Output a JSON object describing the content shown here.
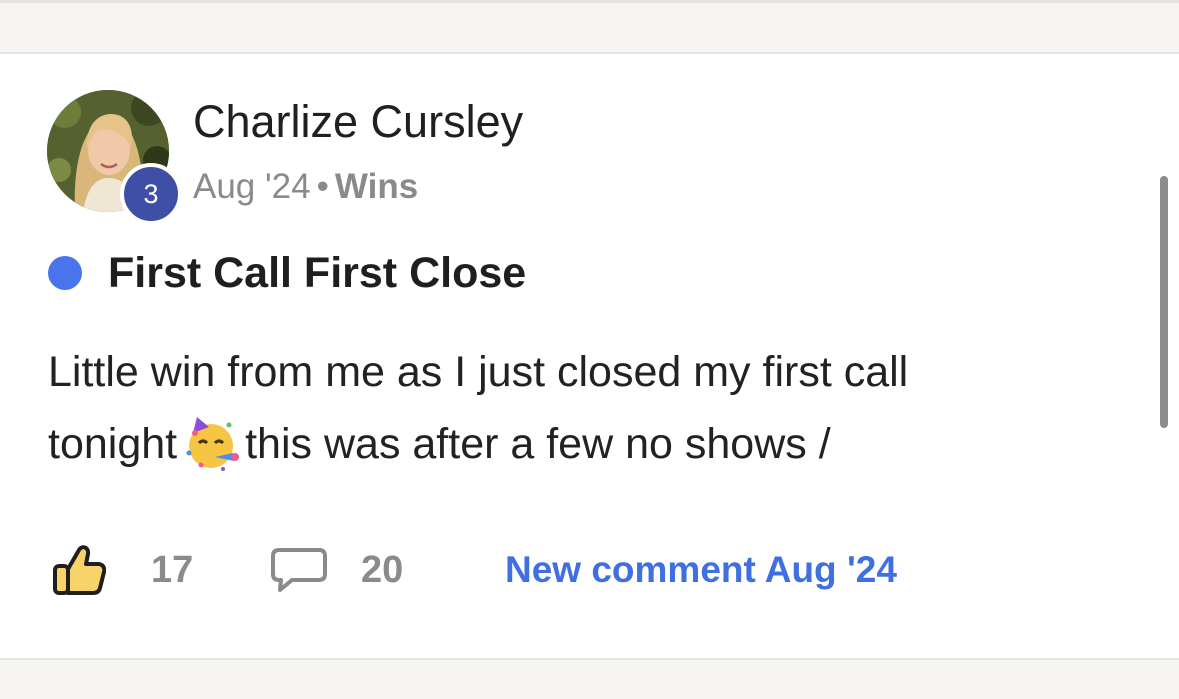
{
  "post": {
    "author": {
      "name": "Charlize Cursley",
      "level": "3"
    },
    "date": "Aug '24",
    "separator": "•",
    "category": "Wins",
    "title": "First Call First Close",
    "body": {
      "line1": "Little win from me as I just closed my first call",
      "line2_before_emoji": "tonight",
      "emoji": "partying-face",
      "line2_after_emoji": "this was after a few no shows /"
    },
    "stats": {
      "likes": "17",
      "comments": "20",
      "last_activity": "New comment Aug '24"
    }
  },
  "icons": {
    "like": "thumbs-up-icon",
    "comment": "comment-bubble-icon",
    "pinned": "blue-dot-icon"
  },
  "colors": {
    "accent_blue": "#3f6fe0",
    "pin_dot": "#4a73ee",
    "level_badge": "#3f4fa6",
    "like_icon_fill": "#f7d36a",
    "muted_text": "#8a8a8a"
  }
}
